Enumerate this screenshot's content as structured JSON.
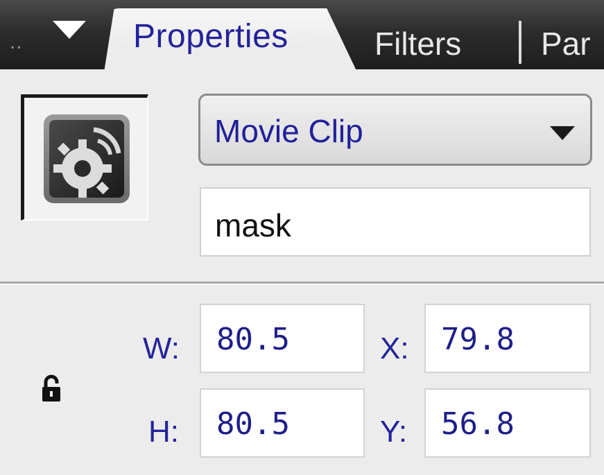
{
  "tabs": {
    "grip": "..",
    "active": "Properties",
    "second": "Filters",
    "third": "Par"
  },
  "symbol": {
    "icon": "movie-clip-symbol-icon",
    "type_value": "Movie Clip",
    "instance_name": "mask"
  },
  "dimensions": {
    "w_label": "W:",
    "w_value": "80.5",
    "h_label": "H:",
    "h_value": "80.5",
    "x_label": "X:",
    "x_value": "79.8",
    "y_label": "Y:",
    "y_value": "56.8",
    "lock_icon": "lock-icon"
  },
  "colors": {
    "label_blue": "#24249a",
    "tab_strip": "#2c2c2c",
    "panel_bg": "#ececec"
  }
}
